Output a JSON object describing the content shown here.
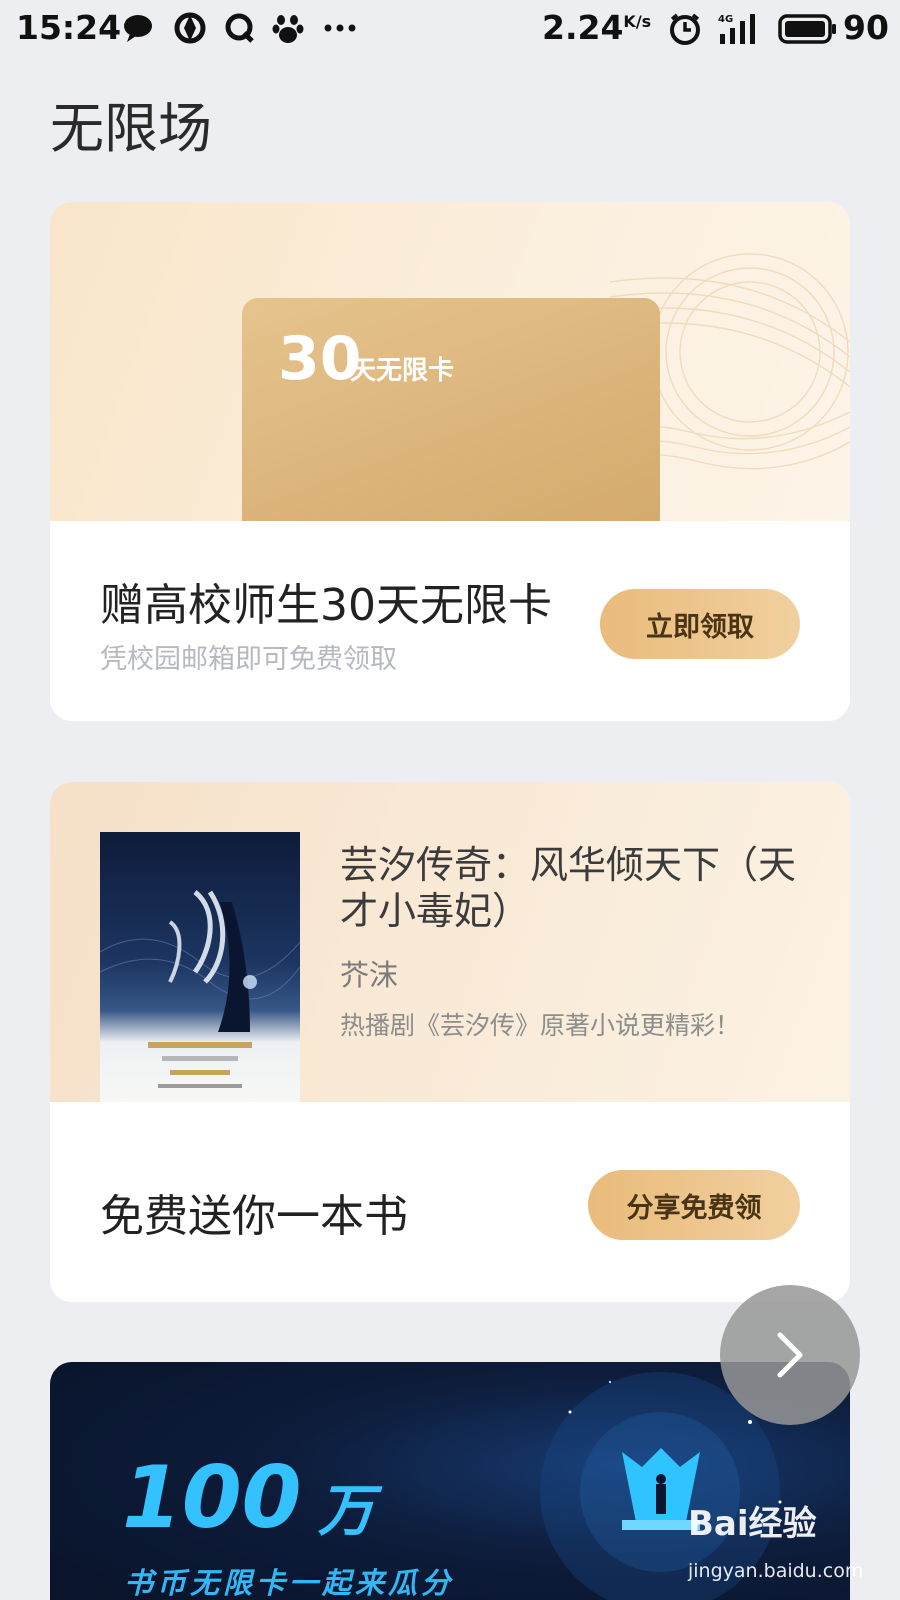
{
  "status_bar": {
    "time": "15:24",
    "network_speed": "2.24",
    "network_unit": "K/s",
    "signal_label": "4G",
    "battery": "90",
    "icons": [
      "chat-bubble-icon",
      "sync-app-icon",
      "q-app-icon",
      "baidu-paw-icon",
      "more-dots-icon",
      "alarm-icon",
      "signal-4g-icon",
      "battery-icon"
    ]
  },
  "page": {
    "title": "无限场"
  },
  "card_unlimited": {
    "card_days": "30",
    "card_name": "天无限卡",
    "title": "赠高校师生30天无限卡",
    "subtitle": "凭校园邮箱即可免费领取",
    "button": "立即领取"
  },
  "card_book": {
    "book_title": "芸汐传奇：风华倾天下（天才小毒妃）",
    "author": "芥沫",
    "description": "热播剧《芸汐传》原著小说更精彩！",
    "promo_title": "免费送你一本书",
    "button": "分享免费领"
  },
  "card_coins": {
    "amount": "100",
    "amount_unit": "万",
    "tagline": "书币无限卡一起来瓜分"
  },
  "next_button": {
    "icon": "chevron-right-icon"
  },
  "watermark": {
    "brand": "Bai经验",
    "url": "jingyan.baidu.com"
  },
  "colors": {
    "background": "#eceef1",
    "button_gold_start": "#e9bb7b",
    "button_gold_end": "#f1d09f",
    "gold_card": "#dcb57c",
    "accent_blue": "#33c2ff",
    "dark_navy": "#0d1c3a"
  }
}
